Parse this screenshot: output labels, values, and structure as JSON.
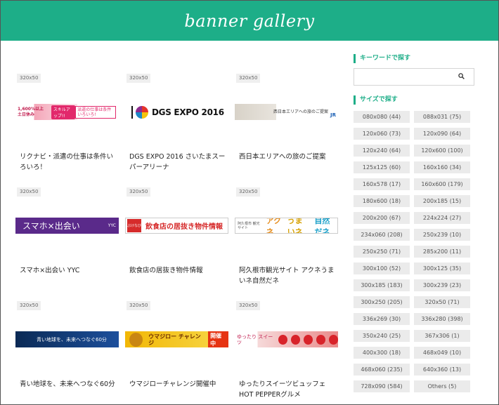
{
  "header": {
    "logo": "banner gallery"
  },
  "cards": [
    {
      "size": "320x50",
      "title": "リクナビ・派遣の仕事は条件いろいろ！"
    },
    {
      "size": "320x50",
      "title": "DGS EXPO 2016 さいたまスーパーアリーナ"
    },
    {
      "size": "320x50",
      "title": "西日本エリアへの旅のご提案"
    },
    {
      "size": "320x50",
      "title": "スマホ×出会い YYC"
    },
    {
      "size": "320x50",
      "title": "飲食店の居抜き物件情報"
    },
    {
      "size": "320x50",
      "title": "阿久根市観光サイト アクネうまいネ自然だネ"
    },
    {
      "size": "320x50",
      "title": "青い地球を、未来へつなぐ60分"
    },
    {
      "size": "320x50",
      "title": "ウマジローチャレンジ開催中"
    },
    {
      "size": "320x50",
      "title": "ゆったりスイーツビュッフェ HOT PEPPERグルメ"
    }
  ],
  "banners": {
    "riku": {
      "tag": "1,600%以上 土日休み",
      "pill": "スキルアップ!!",
      "box": "派遣の仕事は条件いろいろ!"
    },
    "dgs": {
      "text": "DGS EXPO 2016"
    },
    "west": {
      "text": "西日本エリアへの旅のご提案",
      "jr": "JR"
    },
    "yyc": {
      "text": "スマホ×出会い",
      "brand": "YYC"
    },
    "jimu": {
      "logo": "ぶけなび",
      "text": "飲食店の居抜き物件情報"
    },
    "aku": {
      "small": "阿久根市 観光サイト",
      "a": "アクネ",
      "b": "うまいネ",
      "c": "自然だネ"
    },
    "blue": {
      "text": "青い地球を、未来へつなぐ60分",
      "num": "60"
    },
    "uma": {
      "text": "ウマジロー チャレンジ",
      "live": "開催中"
    },
    "sweet": {
      "text": "ゆったり スイーツ"
    }
  },
  "sidebar": {
    "keyword_heading": "キーワードで探す",
    "search_placeholder": "",
    "sizes_heading": "サイズで探す",
    "sizes": [
      "080x080 (44)",
      "088x031 (75)",
      "120x060 (73)",
      "120x090 (64)",
      "120x240 (64)",
      "120x600 (100)",
      "125x125 (60)",
      "160x160 (34)",
      "160x578 (17)",
      "160x600 (179)",
      "180x600 (18)",
      "200x185 (15)",
      "200x200 (67)",
      "224x224 (27)",
      "234x060 (208)",
      "250x239 (10)",
      "250x250 (71)",
      "285x200 (11)",
      "300x100 (52)",
      "300x125 (35)",
      "300x185 (183)",
      "300x239 (23)",
      "300x250 (205)",
      "320x50 (71)",
      "336x269 (30)",
      "336x280 (398)",
      "350x240 (25)",
      "367x306 (1)",
      "400x300 (18)",
      "468x049 (10)",
      "468x060 (235)",
      "640x360 (13)",
      "728x090 (584)",
      "Others (5)"
    ]
  },
  "colors": {
    "accent": "#1dae88"
  }
}
